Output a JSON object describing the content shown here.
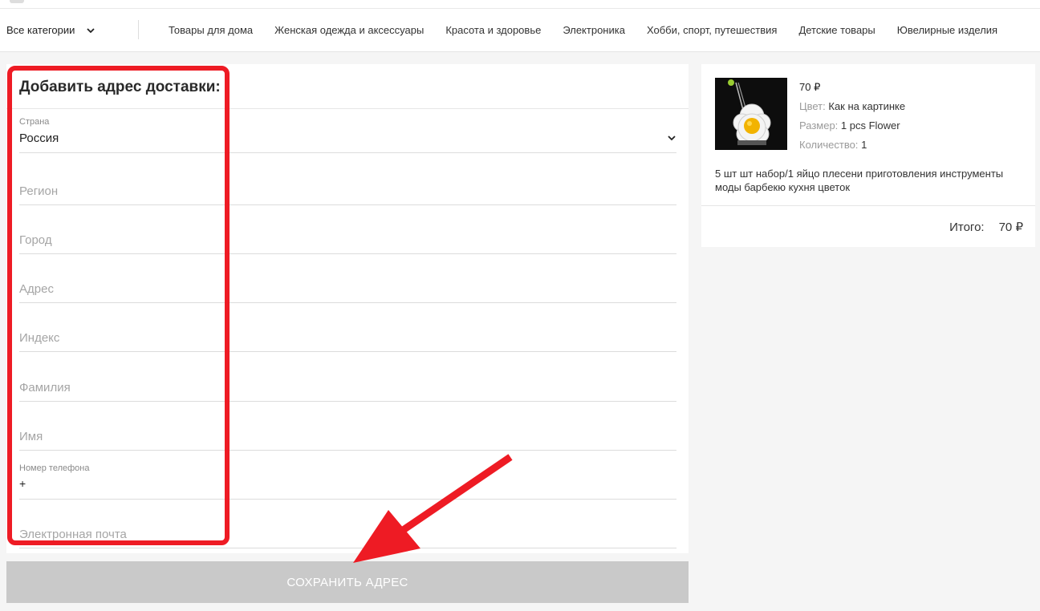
{
  "categories_bar": {
    "all_label": "Все категории",
    "items": [
      "Товары для дома",
      "Женская одежда и аксессуары",
      "Красота и здоровье",
      "Электроника",
      "Хобби, спорт, путешествия",
      "Детские товары",
      "Ювелирные изделия"
    ]
  },
  "form": {
    "title": "Добавить адрес доставки:",
    "country": {
      "label": "Страна",
      "value": "Россия"
    },
    "region_placeholder": "Регион",
    "city_placeholder": "Город",
    "address_placeholder": "Адрес",
    "index_placeholder": "Индекс",
    "lastname_placeholder": "Фамилия",
    "firstname_placeholder": "Имя",
    "phone": {
      "label": "Номер телефона",
      "value": "+"
    },
    "email_placeholder": "Электронная почта",
    "save_label": "СОХРАНИТЬ АДРЕС"
  },
  "order": {
    "price": "70 ₽",
    "color_label": "Цвет:",
    "color_value": "Как на картинке",
    "size_label": "Размер:",
    "size_value": "1 pcs Flower",
    "qty_label": "Количество:",
    "qty_value": "1",
    "description": "5 шт шт набор/1 яйцо плесени приготовления инструменты моды барбекю кухня цветок",
    "total_label": "Итого:",
    "total_value": "70 ₽"
  },
  "colors": {
    "highlight": "#ee1b24",
    "button_bg": "#c9c9c9"
  }
}
